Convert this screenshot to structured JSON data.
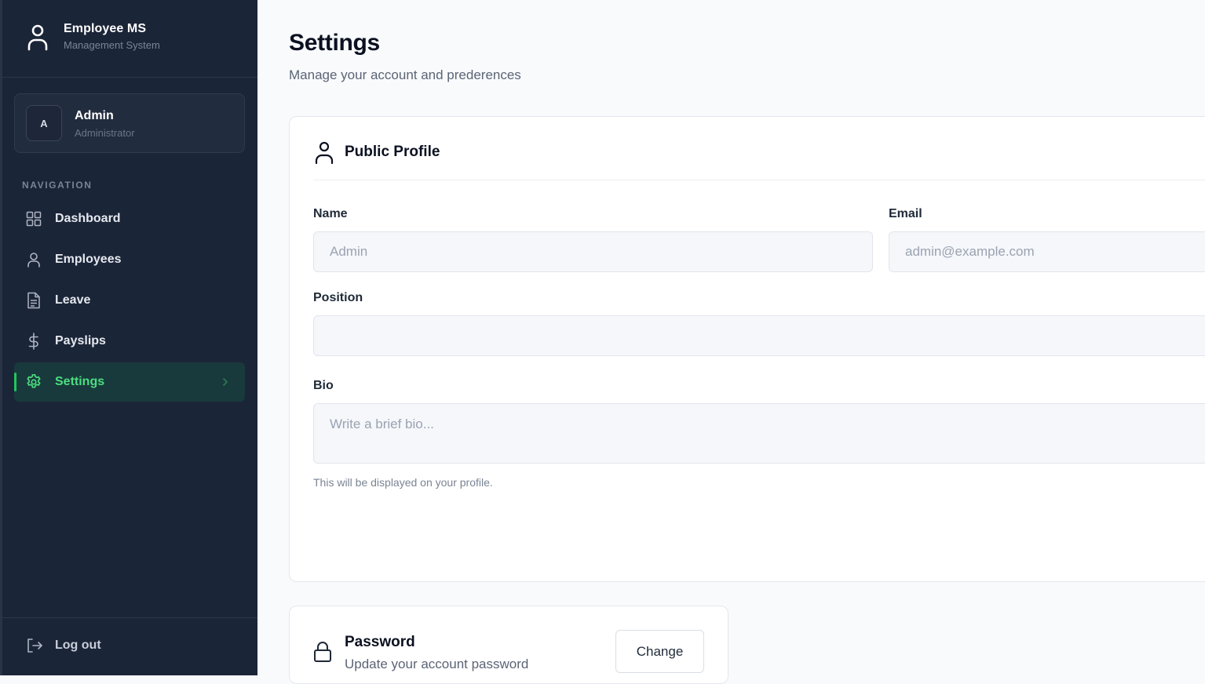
{
  "brand": {
    "title": "Employee MS",
    "subtitle": "Management System"
  },
  "user": {
    "initial": "A",
    "name": "Admin",
    "role": "Administrator"
  },
  "nav": {
    "section_label": "NAVIGATION",
    "items": [
      {
        "label": "Dashboard",
        "icon": "grid-icon"
      },
      {
        "label": "Employees",
        "icon": "user-icon"
      },
      {
        "label": "Leave",
        "icon": "document-icon"
      },
      {
        "label": "Payslips",
        "icon": "dollar-icon"
      },
      {
        "label": "Settings",
        "icon": "gear-icon",
        "active": true
      }
    ],
    "logout_label": "Log out"
  },
  "page": {
    "title": "Settings",
    "subtitle": "Manage your account and prederences"
  },
  "profile": {
    "title": "Public Profile",
    "name_label": "Name",
    "name_placeholder": "Admin",
    "email_label": "Email",
    "email_placeholder": "admin@example.com",
    "position_label": "Position",
    "position_value": "",
    "bio_label": "Bio",
    "bio_placeholder": "Write a brief bio...",
    "bio_hint": "This will be displayed on your profile."
  },
  "password": {
    "title": "Password",
    "subtitle": "Update your account password",
    "button_label": "Change"
  },
  "colors": {
    "sidebar_bg": "#1b2538",
    "accent": "#22c55e",
    "active_bg": "#193a3c"
  }
}
